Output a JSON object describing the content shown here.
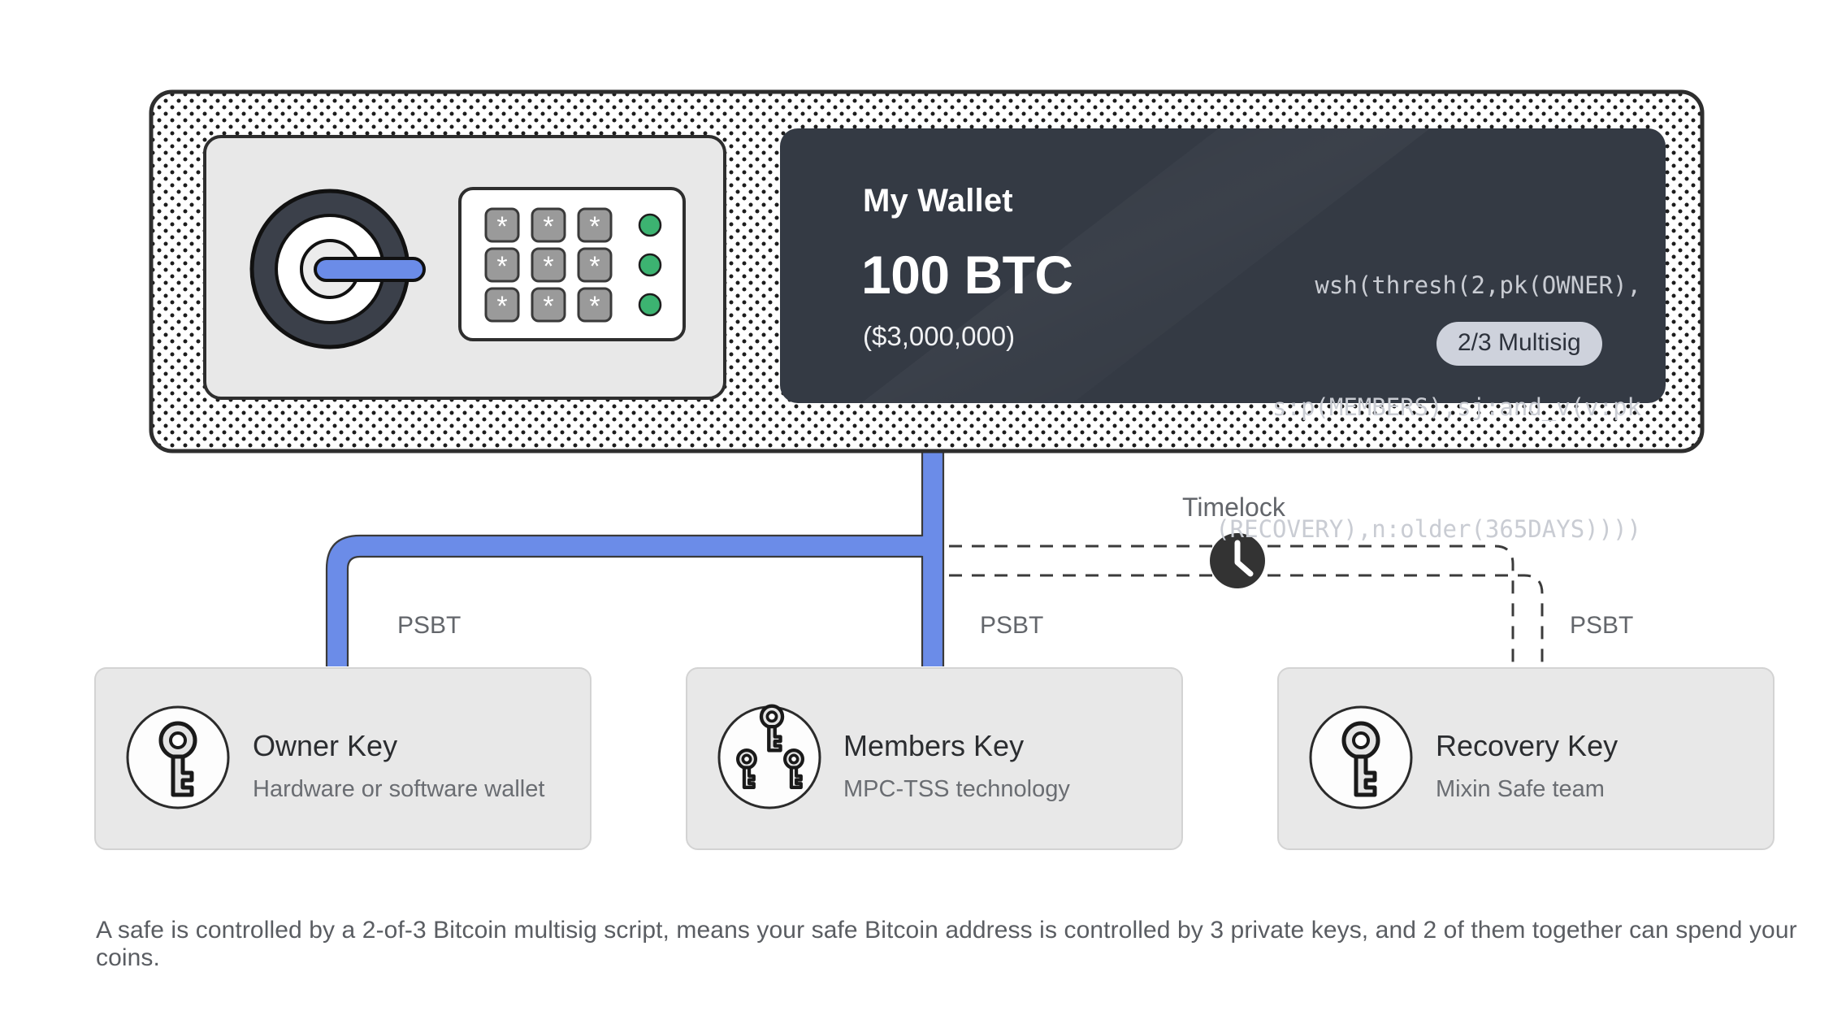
{
  "safe": {
    "dial": {
      "icon": "safe-dial-icon"
    },
    "keypad": {
      "key_label": "*",
      "rows": 3,
      "cols": 3,
      "led_count": 3,
      "led_color": "#3cb371"
    }
  },
  "wallet": {
    "name": "My Wallet",
    "amount": "100 BTC",
    "fiat": "($3,000,000)",
    "descriptor_lines": [
      "wsh(thresh(2,pk(OWNER),",
      "s:p(MEMBERS),sj:and_v(v:pk",
      "(RECOVERY),n:older(365DAYS))))"
    ],
    "badge": "2/3 Multisig",
    "card_color": "#343a44",
    "badge_color": "#ced2dc"
  },
  "connections": {
    "psbt_label": "PSBT",
    "timelock_label": "Timelock",
    "solid_color": "#6b8ce8",
    "dashed_color": "#3b3b3b",
    "timelock_node_color": "#333333",
    "edges": [
      {
        "label": "PSBT",
        "style": "solid",
        "target": "Owner Key"
      },
      {
        "label": "PSBT",
        "style": "solid",
        "target": "Members Key"
      },
      {
        "label": "PSBT",
        "style": "dashed",
        "target": "Recovery Key"
      }
    ]
  },
  "keys": [
    {
      "title": "Owner Key",
      "subtitle": "Hardware or software wallet",
      "icon": "single-key-icon"
    },
    {
      "title": "Members Key",
      "subtitle": "MPC-TSS technology",
      "icon": "three-keys-icon"
    },
    {
      "title": "Recovery Key",
      "subtitle": "Mixin Safe team",
      "icon": "single-key-icon"
    }
  ],
  "caption": "A safe is controlled by a 2-of-3 Bitcoin multisig script, means your safe Bitcoin address is controlled by 3 private keys, and 2 of them together can spend your coins."
}
